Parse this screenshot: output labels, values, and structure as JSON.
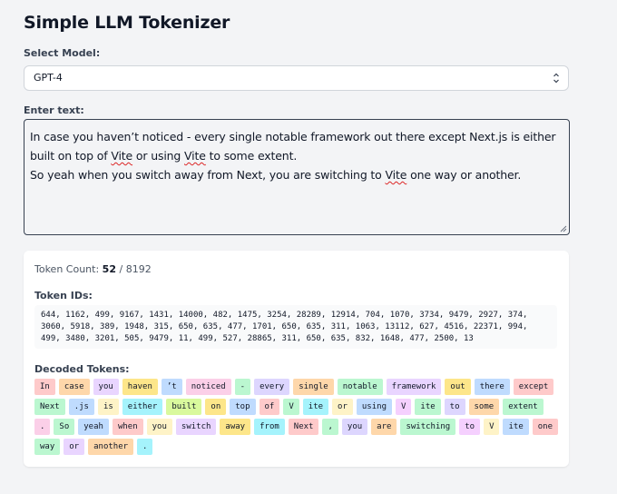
{
  "app": {
    "title": "Simple LLM Tokenizer"
  },
  "model": {
    "label": "Select Model:",
    "selected": "GPT-4"
  },
  "input": {
    "label": "Enter text:",
    "line1_a": "In case you haven’t noticed - every single notable framework out there except Next.js is either built on top of ",
    "vite1": "Vite",
    "line1_b": " or using ",
    "vite2": "Vite",
    "line1_c": " to some extent.\nSo yeah when you switch away from Next, you are switching to ",
    "vite3": "Vite",
    "line1_d": " one way or another."
  },
  "results": {
    "count_label": "Token Count:",
    "count_value": "52",
    "count_sep": "/",
    "count_max": "8192",
    "ids_label": "Token IDs:",
    "ids_text": "644, 1162, 499, 9167, 1431, 14000, 482, 1475, 3254, 28289, 12914, 704, 1070, 3734, 9479, 2927, 374, 3060, 5918, 389, 1948, 315, 650, 635, 477, 1701, 650, 635, 311, 1063, 13112, 627, 4516, 22371, 994, 499, 3480, 3201, 505, 9479, 11, 499, 527, 28865, 311, 650, 635, 832, 1648, 477, 2500, 13",
    "decoded_label": "Decoded Tokens:",
    "tokens": [
      {
        "text": "In",
        "color": "#fecaca"
      },
      {
        "text": "case",
        "color": "#fed7aa"
      },
      {
        "text": "you",
        "color": "#e9d5ff"
      },
      {
        "text": "haven",
        "color": "#fde68a"
      },
      {
        "text": "’t",
        "color": "#bfdbfe"
      },
      {
        "text": "noticed",
        "color": "#fbcfe8"
      },
      {
        "text": "-",
        "color": "#bbf7d0"
      },
      {
        "text": "every",
        "color": "#ddd6fe"
      },
      {
        "text": "single",
        "color": "#fed7aa"
      },
      {
        "text": "notable",
        "color": "#bbf7d0"
      },
      {
        "text": "framework",
        "color": "#e9d5ff"
      },
      {
        "text": "out",
        "color": "#fde68a"
      },
      {
        "text": "there",
        "color": "#bfdbfe"
      },
      {
        "text": "except",
        "color": "#fecaca"
      },
      {
        "text": "Next",
        "color": "#bbf7d0"
      },
      {
        "text": ".js",
        "color": "#bfdbfe"
      },
      {
        "text": "is",
        "color": "#fef3c7"
      },
      {
        "text": "either",
        "color": "#a5f3fc"
      },
      {
        "text": "built",
        "color": "#d9f99d"
      },
      {
        "text": "on",
        "color": "#fde68a"
      },
      {
        "text": "top",
        "color": "#bfdbfe"
      },
      {
        "text": "of",
        "color": "#fecaca"
      },
      {
        "text": "V",
        "color": "#bbf7d0"
      },
      {
        "text": "ite",
        "color": "#a5f3fc"
      },
      {
        "text": "or",
        "color": "#fef3c7"
      },
      {
        "text": "using",
        "color": "#bfdbfe"
      },
      {
        "text": "V",
        "color": "#f5d0fe"
      },
      {
        "text": "ite",
        "color": "#bbf7d0"
      },
      {
        "text": "to",
        "color": "#ddd6fe"
      },
      {
        "text": "some",
        "color": "#fed7aa"
      },
      {
        "text": "extent",
        "color": "#bbf7d0"
      },
      {
        "text": ".",
        "color": "#fbcfe8"
      },
      {
        "text": "So",
        "color": "#bbf7d0"
      },
      {
        "text": "yeah",
        "color": "#bfdbfe"
      },
      {
        "text": "when",
        "color": "#fecaca"
      },
      {
        "text": "you",
        "color": "#fef3c7"
      },
      {
        "text": "switch",
        "color": "#e9d5ff"
      },
      {
        "text": "away",
        "color": "#fde68a"
      },
      {
        "text": "from",
        "color": "#a5f3fc"
      },
      {
        "text": "Next",
        "color": "#fecaca"
      },
      {
        "text": ",",
        "color": "#bbf7d0"
      },
      {
        "text": "you",
        "color": "#ddd6fe"
      },
      {
        "text": "are",
        "color": "#fed7aa"
      },
      {
        "text": "switching",
        "color": "#bbf7d0"
      },
      {
        "text": "to",
        "color": "#f5d0fe"
      },
      {
        "text": "V",
        "color": "#fef3c7"
      },
      {
        "text": "ite",
        "color": "#bfdbfe"
      },
      {
        "text": "one",
        "color": "#fecaca"
      },
      {
        "text": "way",
        "color": "#bbf7d0"
      },
      {
        "text": "or",
        "color": "#e9d5ff"
      },
      {
        "text": "another",
        "color": "#fed7aa"
      },
      {
        "text": ".",
        "color": "#a5f3fc"
      }
    ]
  }
}
